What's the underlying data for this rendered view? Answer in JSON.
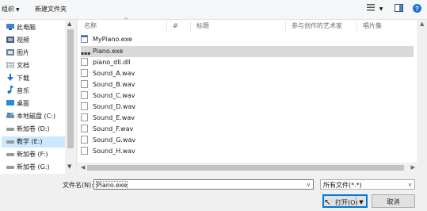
{
  "toolbar": {
    "organize_label": "组织",
    "new_folder_label": "新建文件夹"
  },
  "nav": {
    "items": [
      {
        "label": "此电脑",
        "icon": "computer-icon"
      },
      {
        "label": "视频",
        "icon": "video-folder-icon"
      },
      {
        "label": "图片",
        "icon": "picture-folder-icon"
      },
      {
        "label": "文档",
        "icon": "document-folder-icon"
      },
      {
        "label": "下载",
        "icon": "download-folder-icon"
      },
      {
        "label": "音乐",
        "icon": "music-folder-icon"
      },
      {
        "label": "桌面",
        "icon": "desktop-folder-icon"
      },
      {
        "label": "本地磁盘 (C:)",
        "icon": "drive-icon"
      },
      {
        "label": "新加卷 (D:)",
        "icon": "drive-icon"
      },
      {
        "label": "教学 (E:)",
        "icon": "drive-icon",
        "selected": true
      },
      {
        "label": "新加卷 (F:)",
        "icon": "drive-icon"
      },
      {
        "label": "新加卷 (G:)",
        "icon": "drive-icon"
      }
    ]
  },
  "columns": {
    "name": "名称",
    "number": "#",
    "title": "标题",
    "artist": "参与创作的艺术家",
    "album": "唱片集"
  },
  "files": [
    {
      "name": "MyPiano.exe",
      "icon": "application-icon"
    },
    {
      "name": "Piano.exe",
      "icon": "exe-file-icon",
      "selected": true
    },
    {
      "name": "piano_dll.dll",
      "icon": "file-icon"
    },
    {
      "name": "Sound_A.wav",
      "icon": "file-icon"
    },
    {
      "name": "Sound_B.wav",
      "icon": "file-icon"
    },
    {
      "name": "Sound_C.wav",
      "icon": "file-icon"
    },
    {
      "name": "Sound_D.wav",
      "icon": "file-icon"
    },
    {
      "name": "Sound_E.wav",
      "icon": "file-icon"
    },
    {
      "name": "Sound_F.wav",
      "icon": "file-icon"
    },
    {
      "name": "Sound_G.wav",
      "icon": "file-icon"
    },
    {
      "name": "Sound_H.wav",
      "icon": "file-icon"
    }
  ],
  "footer": {
    "filename_label": "文件名(N):",
    "filename_value": "Piano.exe",
    "filetype_value": "所有文件(*.*)",
    "open_label": "打开(O)",
    "cancel_label": "取消"
  },
  "colors": {
    "selection": "#cce8ff",
    "accent": "#0078d7"
  }
}
